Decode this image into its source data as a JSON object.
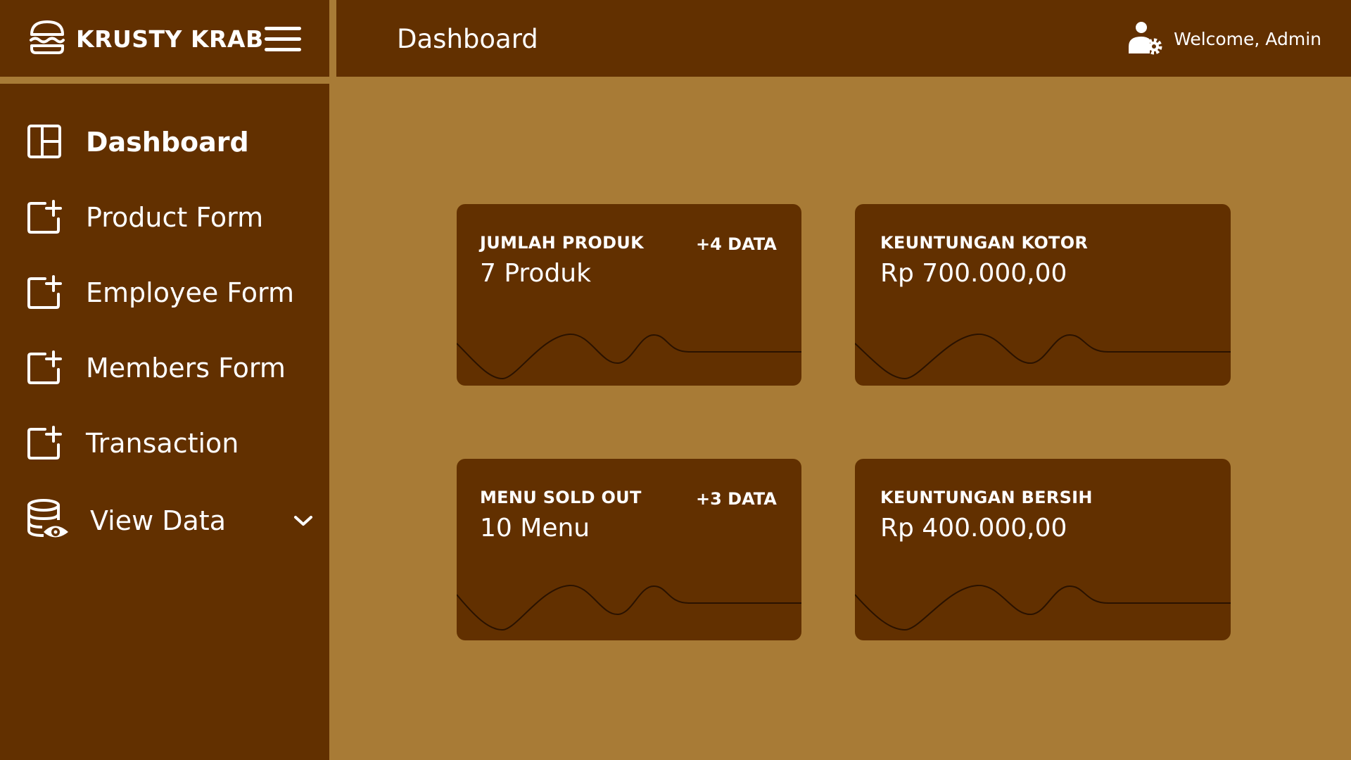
{
  "brand": {
    "name": "KRUSTY KRAB",
    "logo_icon": "burger-icon",
    "menu_icon": "hamburger-menu-icon"
  },
  "header": {
    "title": "Dashboard",
    "welcome": "Welcome, Admin",
    "user_icon": "user-gear-icon"
  },
  "sidebar": {
    "items": [
      {
        "label": "Dashboard",
        "icon": "layout-icon",
        "active": true
      },
      {
        "label": "Product Form",
        "icon": "add-document-icon"
      },
      {
        "label": "Employee Form",
        "icon": "add-document-icon"
      },
      {
        "label": "Members Form",
        "icon": "add-document-icon"
      },
      {
        "label": "Transaction",
        "icon": "add-document-icon"
      },
      {
        "label": "View Data",
        "icon": "database-eye-icon",
        "expandable": true,
        "expand_icon": "chevron-down-icon"
      }
    ]
  },
  "cards": [
    {
      "label": "JUMLAH PRODUK",
      "badge": "+4 DATA",
      "value": "7 Produk"
    },
    {
      "label": "KEUNTUNGAN KOTOR",
      "badge": "",
      "value": "Rp 700.000,00"
    },
    {
      "label": "MENU SOLD OUT",
      "badge": "+3 DATA",
      "value": "10 Menu"
    },
    {
      "label": "KEUNTUNGAN BERSIH",
      "badge": "",
      "value": "Rp 400.000,00"
    }
  ],
  "colors": {
    "background": "#A87B36",
    "panel": "#623000",
    "text": "#FFFFFF"
  }
}
